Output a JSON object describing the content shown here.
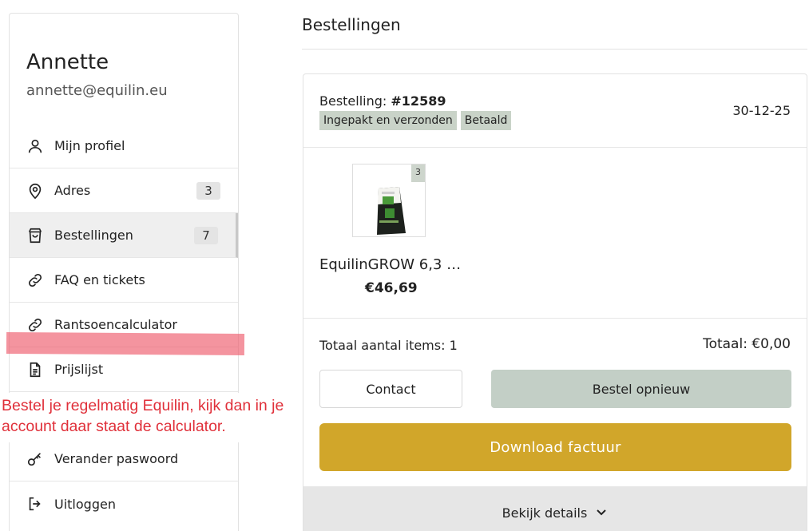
{
  "account": {
    "name": "Annette",
    "email": "annette@equilin.eu"
  },
  "sidebar": {
    "items": [
      {
        "label": "Mijn profiel",
        "icon": "user-icon"
      },
      {
        "label": "Adres",
        "icon": "location-pin-icon",
        "count": "3"
      },
      {
        "label": "Bestellingen",
        "icon": "shopping-bag-icon",
        "count": "7",
        "active": true
      },
      {
        "label": "FAQ en tickets",
        "icon": "link-icon"
      },
      {
        "label": "Rantsoencalculator",
        "icon": "link-icon"
      },
      {
        "label": "Prijslijst",
        "icon": "document-icon"
      },
      {
        "label": "Verander paswoord",
        "icon": "key-icon"
      },
      {
        "label": "Uitloggen",
        "icon": "logout-icon"
      }
    ]
  },
  "annotation": {
    "note": "Bestel je regelmatig Equilin, kijk dan in je account daar staat de calculator.",
    "highlight_color": "#ee5a6c",
    "text_color": "#e0303a"
  },
  "main": {
    "title": "Bestellingen",
    "order": {
      "label": "Bestelling:",
      "number": "#12589",
      "date": "30-12-25",
      "badges": [
        "Ingepakt en verzonden",
        "Betaald"
      ],
      "product": {
        "name": "EquilinGROW 6,3 …",
        "price": "€46,69",
        "quantity": "3"
      },
      "total_items": "Totaal aantal items: 1",
      "total": "Totaal: €0,00",
      "contact_label": "Contact",
      "reorder_label": "Bestel opnieuw",
      "invoice_label": "Download factuur",
      "details_label": "Bekijk details"
    }
  },
  "colors": {
    "badge_bg": "#c9d3c8",
    "reorder_bg": "#c3cfc6",
    "invoice_bg": "#d1a62a",
    "details_bg": "#e6e6e6"
  }
}
